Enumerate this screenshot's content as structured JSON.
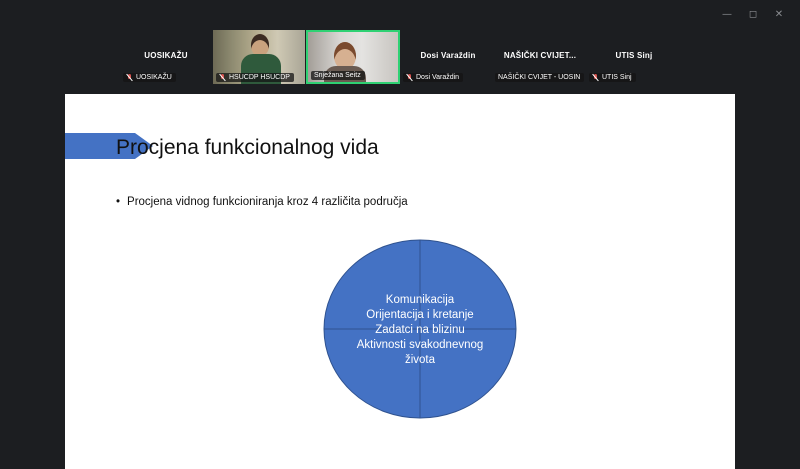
{
  "window_controls": {
    "minimize": "—",
    "maximize": "◻",
    "close": "✕"
  },
  "participants": [
    {
      "name": "UOSIKAŽU",
      "label": "UOSIKAŽU",
      "muted": true
    },
    {
      "name": "",
      "label": "HSUCDP HSUCDP",
      "muted": true
    },
    {
      "name": "",
      "label": "Snježana Seitz",
      "muted": false
    },
    {
      "name": "Dosi Varaždin",
      "label": "Dosi Varaždin",
      "muted": true
    },
    {
      "name": "NAŠIČKI CVIJET...",
      "label": "NAŠIČKI CVIJET - UOSIN",
      "muted": false
    },
    {
      "name": "UTIS Sinj",
      "label": "UTIS Sinj",
      "muted": true
    }
  ],
  "slide": {
    "title": "Procjena funkcionalnog vida",
    "bullet": "Procjena vidnog funkcioniranja kroz 4 različita područja",
    "bullet_marker": "•",
    "circle_lines": [
      "Komunikacija",
      "Orijentacija i kretanje",
      "Zadatci na blizinu",
      "Aktivnosti svakodnevnog",
      "života"
    ]
  },
  "colors": {
    "accent_chevron": "#4472c4",
    "circle_fill": "#4472c4",
    "active_speaker": "#2fd173",
    "muted_mic": "#d9534f"
  }
}
